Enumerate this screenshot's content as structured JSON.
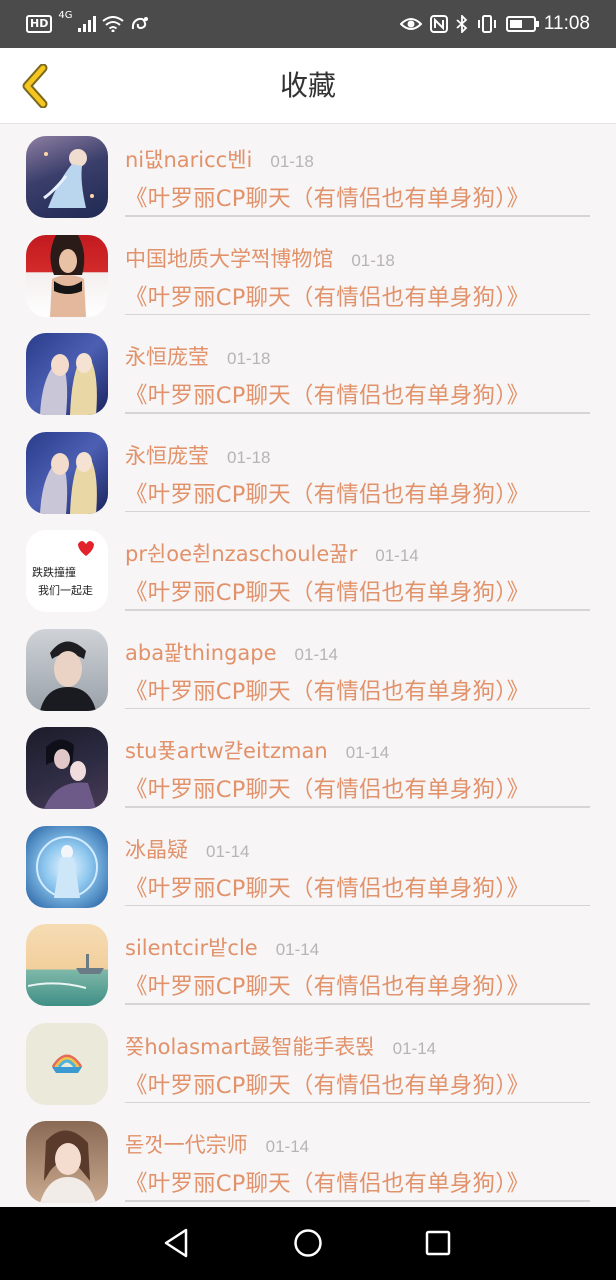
{
  "status_bar": {
    "hd": "HD",
    "network": "4G",
    "time": "11:08"
  },
  "header": {
    "title": "收藏",
    "back_icon": "chevron-left-icon"
  },
  "items": [
    {
      "name": "ni댒naricc벤i",
      "date": "01-18",
      "group": "《叶罗丽CP聊天（有情侣也有单身狗）》",
      "avatar": "anime-girl-blue-dress"
    },
    {
      "name": "中国地质大学쩍博物馆",
      "date": "01-18",
      "group": "《叶罗丽CP聊天（有情侣也有单身狗）》",
      "avatar": "woman-photo"
    },
    {
      "name": "永恒庞莹",
      "date": "01-18",
      "group": "《叶罗丽CP聊天（有情侣也有单身狗）》",
      "avatar": "anime-couple"
    },
    {
      "name": "永恒庞莹",
      "date": "01-18",
      "group": "《叶罗丽CP聊天（有情侣也有单身狗）》",
      "avatar": "anime-couple"
    },
    {
      "name": "pr쉰oe췬nzaschoule꿆r",
      "date": "01-14",
      "group": "《叶罗丽CP聊天（有情侣也有单身狗）》",
      "avatar": "text-heart",
      "avatar_text": [
        "跌跌撞撞",
        "我们一起走"
      ]
    },
    {
      "name": "aba팙thingape",
      "date": "01-14",
      "group": "《叶罗丽CP聊天（有情侣也有单身狗）》",
      "avatar": "man-portrait"
    },
    {
      "name": "stu푳artw캳eitzman",
      "date": "01-14",
      "group": "《叶罗丽CP聊天（有情侣也有单身狗）》",
      "avatar": "anime-dark-couple"
    },
    {
      "name": "冰晶疑",
      "date": "01-14",
      "group": "《叶罗丽CP聊天（有情侣也有单身狗）》",
      "avatar": "ice-fairy"
    },
    {
      "name": "silentcir밭cle",
      "date": "01-14",
      "group": "《叶罗丽CP聊天（有情侣也有单身狗）》",
      "avatar": "sea-ship"
    },
    {
      "name": "쫒holasmart晸智能手表뙩",
      "date": "01-14",
      "group": "《叶罗丽CP聊天（有情侣也有单身狗）》",
      "avatar": "rainbow-badge"
    },
    {
      "name": "돋껏一代宗师",
      "date": "01-14",
      "group": "《叶罗丽CP聊天（有情侣也有单身狗）》",
      "avatar": "girl-photo"
    }
  ],
  "nav_bar": {
    "back_icon": "triangle-back-icon",
    "home_icon": "circle-home-icon",
    "recents_icon": "square-recents-icon"
  }
}
